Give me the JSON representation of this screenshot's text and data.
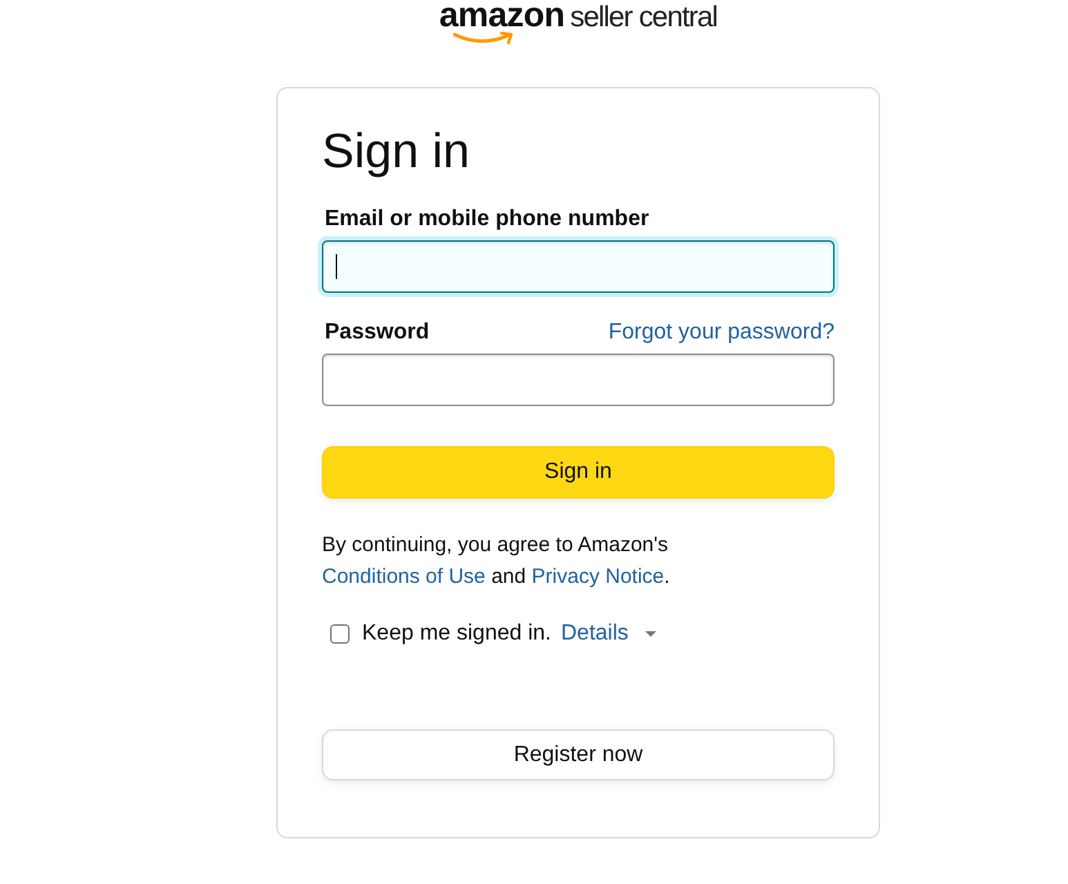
{
  "logo": {
    "brand": "amazon",
    "product": "seller central"
  },
  "title": "Sign in",
  "fields": [
    {
      "label": "Email or mobile phone number",
      "focused": true
    },
    {
      "label": "Password",
      "link": "Forgot your password?",
      "focused": false
    }
  ],
  "submit_button": "Sign in",
  "terms": {
    "parts": [
      {
        "kind": "text",
        "text": "By continuing, you agree to Amazon's "
      },
      {
        "kind": "link",
        "text": "Conditions of Use"
      },
      {
        "kind": "text",
        "text": " and "
      },
      {
        "kind": "link",
        "text": "Privacy Notice"
      },
      {
        "kind": "text",
        "text": "."
      }
    ]
  },
  "keep_signed_in": {
    "label": "Keep me signed in.",
    "link": "Details",
    "checked": false
  },
  "register_button": "Register now"
}
